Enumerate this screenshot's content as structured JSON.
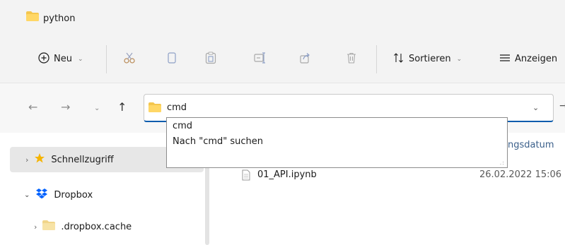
{
  "window": {
    "title": "python"
  },
  "toolbar": {
    "new_label": "Neu",
    "sort_label": "Sortieren",
    "view_label": "Anzeigen"
  },
  "address": {
    "value": "cmd"
  },
  "suggestions": [
    {
      "label": "cmd"
    },
    {
      "label": "Nach \"cmd\" suchen"
    }
  ],
  "sidebar": {
    "items": [
      {
        "label": "Schnellzugriff",
        "icon": "star-icon"
      },
      {
        "label": "Dropbox",
        "icon": "dropbox-icon"
      },
      {
        "label": ".dropbox.cache",
        "icon": "folder-icon"
      }
    ]
  },
  "list": {
    "column_header_partial": "ngsdatum",
    "files": [
      {
        "name": "01_API.ipynb",
        "modified": "26.02.2022 15:06"
      }
    ]
  },
  "colors": {
    "accent": "#0b5cad",
    "folder": "#f4c64e",
    "star": "#f5b400",
    "dropbox": "#0061fe"
  }
}
